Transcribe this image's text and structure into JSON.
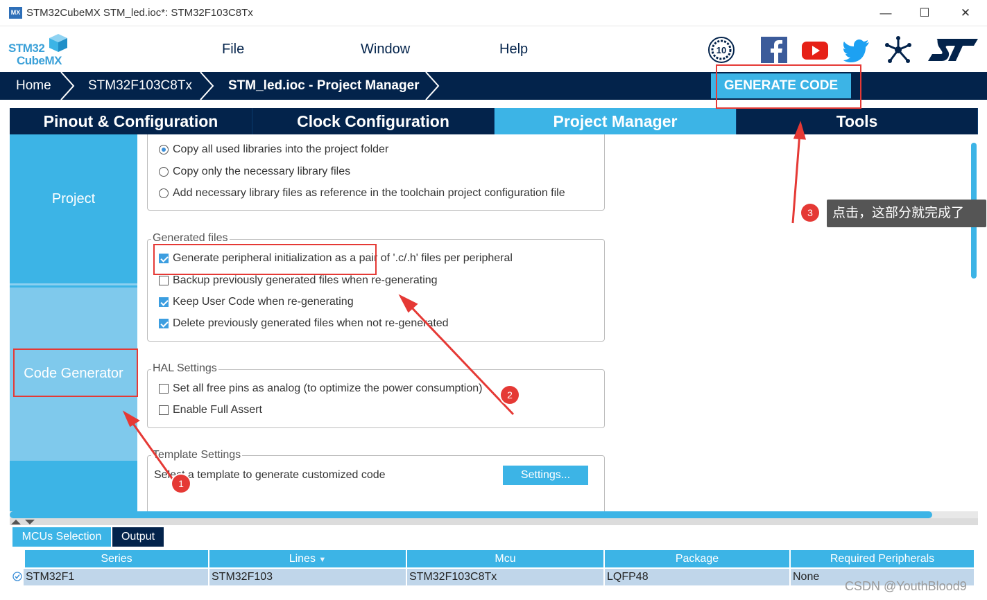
{
  "window": {
    "title": "STM32CubeMX STM_led.ioc*: STM32F103C8Tx",
    "app_icon": "MX",
    "minimize": "—",
    "maximize": "☐",
    "close": "✕"
  },
  "logo": {
    "line1": "STM32",
    "line2": "CubeMX"
  },
  "menu": {
    "file": "File",
    "window": "Window",
    "help": "Help"
  },
  "social_icons": [
    "anniversary-10-icon",
    "facebook-icon",
    "youtube-icon",
    "twitter-icon",
    "network-icon",
    "st-logo-icon"
  ],
  "breadcrumb": {
    "home": "Home",
    "device": "STM32F103C8Tx",
    "project": "STM_led.ioc - Project Manager"
  },
  "generate_button": "GENERATE CODE",
  "tabs": [
    "Pinout & Configuration",
    "Clock Configuration",
    "Project Manager",
    "Tools"
  ],
  "active_tab": "Project Manager",
  "side_nav": {
    "project": "Project",
    "code_generator": "Code Generator"
  },
  "library_options": [
    "Copy all used libraries into the project folder",
    "Copy only the necessary library files",
    "Add necessary library files as reference in the toolchain project configuration file"
  ],
  "generated_files": {
    "legend": "Generated files",
    "options": [
      "Generate peripheral initialization as a pair of '.c/.h' files per peripheral",
      "Backup previously generated files when re-generating",
      "Keep User Code when re-generating",
      "Delete previously generated files when not re-generated"
    ]
  },
  "hal_settings": {
    "legend": "HAL Settings",
    "options": [
      "Set all free pins as analog (to optimize the power consumption)",
      "Enable Full Assert"
    ]
  },
  "template_settings": {
    "legend": "Template Settings",
    "text": "Select a template to generate customized code",
    "button": "Settings..."
  },
  "bottom_tabs": {
    "mcus": "MCUs Selection",
    "output": "Output"
  },
  "table": {
    "headers": [
      "Series",
      "Lines",
      "Mcu",
      "Package",
      "Required Peripherals"
    ],
    "row": [
      "STM32F1",
      "STM32F103",
      "STM32F103C8Tx",
      "LQFP48",
      "None"
    ]
  },
  "annotations": {
    "badge1": "1",
    "badge2": "2",
    "badge3": "3",
    "tooltip": "点击，这部分就完成了",
    "color": "#e53935"
  },
  "watermark": "CSDN @YouthBlood9",
  "colors": {
    "navy": "#03234b",
    "accent": "#3cb4e6",
    "selected_row": "#c0d6ea"
  }
}
